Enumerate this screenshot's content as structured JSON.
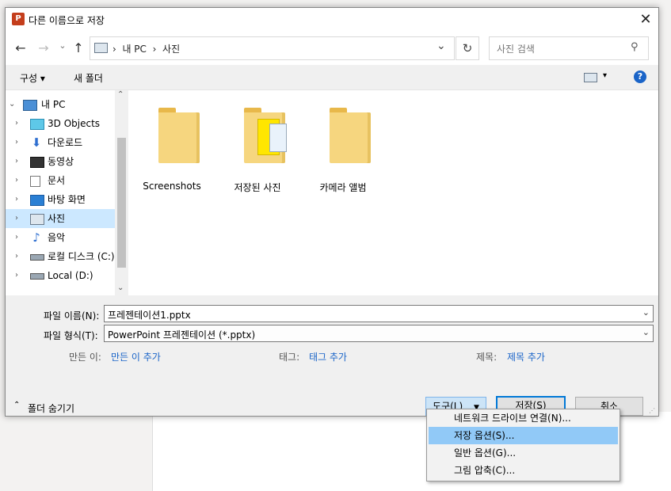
{
  "dialog": {
    "title": "다른 이름으로 저장",
    "app_icon_letter": "P",
    "close": "✕"
  },
  "nav": {
    "back": "←",
    "forward": "→",
    "recent": "⌄",
    "up": "↑",
    "breadcrumb": [
      "내 PC",
      "사진"
    ],
    "breadcrumb_sep": "›",
    "refresh": "↻",
    "search_placeholder": "사진 검색"
  },
  "toolbar": {
    "organize": "구성 ▾",
    "new_folder": "새 폴더",
    "view": "▾",
    "help": "?"
  },
  "tree": [
    {
      "label": "내 PC",
      "icon": "pc-icon",
      "expanded": true
    },
    {
      "label": "3D Objects",
      "icon": "cube-icon"
    },
    {
      "label": "다운로드",
      "icon": "download-icon"
    },
    {
      "label": "동영상",
      "icon": "video-icon"
    },
    {
      "label": "문서",
      "icon": "document-icon"
    },
    {
      "label": "바탕 화면",
      "icon": "desktop-icon"
    },
    {
      "label": "사진",
      "icon": "pictures-icon",
      "selected": true
    },
    {
      "label": "음악",
      "icon": "music-icon"
    },
    {
      "label": "로컬 디스크 (C:)",
      "icon": "drive-icon"
    },
    {
      "label": "Local (D:)",
      "icon": "drive-icon"
    }
  ],
  "folders": [
    {
      "label": "Screenshots"
    },
    {
      "label": "저장된 사진"
    },
    {
      "label": "카메라 앨범"
    }
  ],
  "form": {
    "filename_label": "파일 이름(N):",
    "filename_value": "프레젠테이션1.pptx",
    "filetype_label": "파일 형식(T):",
    "filetype_value": "PowerPoint 프레젠테이션 (*.pptx)",
    "author_label": "만든 이:",
    "author_link": "만든 이 추가",
    "tags_label": "태그:",
    "tags_link": "태그 추가",
    "title_label": "제목:",
    "title_link": "제목 추가"
  },
  "footer": {
    "hide_folders": "폴더 숨기기",
    "tools": "도구(L)",
    "save": "저장(S)",
    "cancel": "취소"
  },
  "menu": [
    {
      "label": "네트워크 드라이브 연결(N)..."
    },
    {
      "label": "저장 옵션(S)...",
      "highlighted": true
    },
    {
      "label": "일반 옵션(G)..."
    },
    {
      "label": "그림 압축(C)..."
    }
  ]
}
